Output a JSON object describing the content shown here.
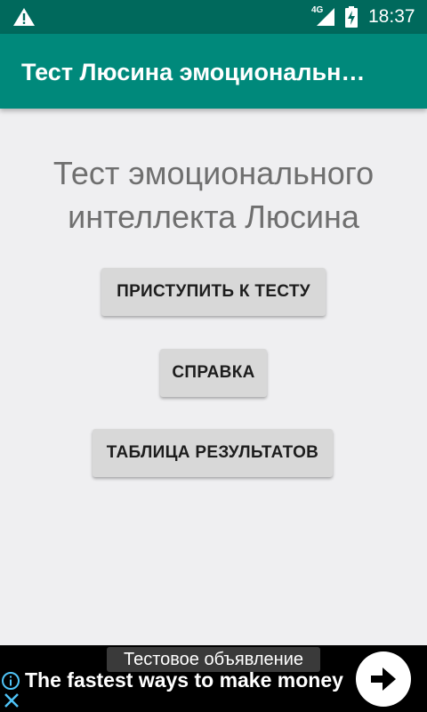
{
  "status_bar": {
    "network": "4G",
    "time": "18:37",
    "icons": [
      "warning-icon",
      "signal-icon",
      "battery-charging-icon"
    ]
  },
  "app_bar": {
    "title": "Тест Люсина эмоциональн…"
  },
  "main": {
    "heading_line1": "Тест эмоционального",
    "heading_line2": "интеллекта Люсина",
    "buttons": {
      "start": "ПРИСТУПИТЬ К ТЕСТУ",
      "help": "СПРАВКА",
      "results": "ТАБЛИЦА РЕЗУЛЬТАТОВ"
    }
  },
  "ad": {
    "label": "Тестовое объявление",
    "headline": "The fastest ways to make money",
    "icons": [
      "info-icon",
      "close-icon",
      "arrow-right-icon"
    ]
  },
  "colors": {
    "status_bar": "#00695c",
    "app_bar": "#00897b",
    "background": "#efeff1",
    "button": "#d8d8d8",
    "ad_background": "#000000",
    "ad_info": "#4fc3f7"
  }
}
